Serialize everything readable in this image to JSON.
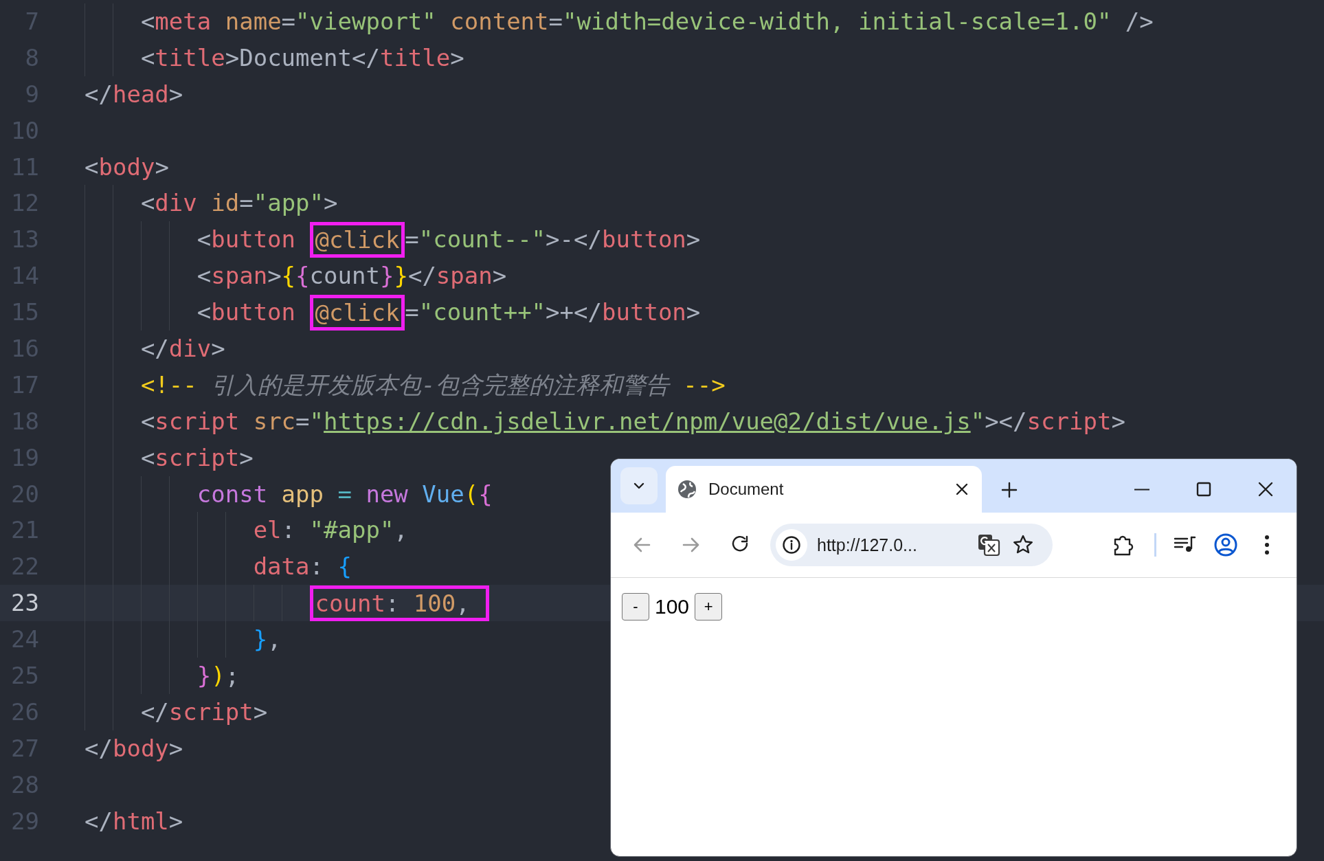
{
  "editor": {
    "lines": [
      {
        "number": "7",
        "current": false,
        "tokens": [
          {
            "text": "    <",
            "kind": "punct"
          },
          {
            "text": "meta",
            "kind": "tag"
          },
          {
            "text": " name",
            "kind": "attr"
          },
          {
            "text": "=",
            "kind": "punct"
          },
          {
            "text": "\"viewport\"",
            "kind": "string"
          },
          {
            "text": " content",
            "kind": "attr"
          },
          {
            "text": "=",
            "kind": "punct"
          },
          {
            "text": "\"width=device-width, initial-scale=1.0\"",
            "kind": "string"
          },
          {
            "text": " />",
            "kind": "punct"
          }
        ]
      },
      {
        "number": "8",
        "current": false,
        "tokens": [
          {
            "text": "    <",
            "kind": "punct"
          },
          {
            "text": "title",
            "kind": "tag"
          },
          {
            "text": ">",
            "kind": "punct"
          },
          {
            "text": "Document",
            "kind": "text"
          },
          {
            "text": "</",
            "kind": "punct"
          },
          {
            "text": "title",
            "kind": "tag"
          },
          {
            "text": ">",
            "kind": "punct"
          }
        ]
      },
      {
        "number": "9",
        "current": false,
        "tokens": [
          {
            "text": "</",
            "kind": "punct"
          },
          {
            "text": "head",
            "kind": "tag"
          },
          {
            "text": ">",
            "kind": "punct"
          }
        ]
      },
      {
        "number": "10",
        "current": false
      },
      {
        "number": "11",
        "current": false,
        "tokens": [
          {
            "text": "<",
            "kind": "punct"
          },
          {
            "text": "body",
            "kind": "tag"
          },
          {
            "text": ">",
            "kind": "punct"
          }
        ]
      },
      {
        "number": "12",
        "current": false,
        "tokens": [
          {
            "text": "    <",
            "kind": "punct"
          },
          {
            "text": "div",
            "kind": "tag"
          },
          {
            "text": " id",
            "kind": "attr"
          },
          {
            "text": "=",
            "kind": "punct"
          },
          {
            "text": "\"app\"",
            "kind": "string"
          },
          {
            "text": ">",
            "kind": "punct"
          }
        ]
      },
      {
        "number": "13",
        "current": false,
        "tokens": [
          {
            "text": "        <",
            "kind": "punct"
          },
          {
            "text": "button ",
            "kind": "tag"
          },
          {
            "kind": "highlight",
            "tokens": [
              {
                "text": "@click",
                "kind": "attr"
              }
            ]
          },
          {
            "text": "=",
            "kind": "punct"
          },
          {
            "text": "\"count--\"",
            "kind": "string"
          },
          {
            "text": ">",
            "kind": "punct"
          },
          {
            "text": "-",
            "kind": "text"
          },
          {
            "text": "</",
            "kind": "punct"
          },
          {
            "text": "button",
            "kind": "tag"
          },
          {
            "text": ">",
            "kind": "punct"
          }
        ]
      },
      {
        "number": "14",
        "current": false,
        "tokens": [
          {
            "text": "        <",
            "kind": "punct"
          },
          {
            "text": "span",
            "kind": "tag"
          },
          {
            "text": ">",
            "kind": "punct"
          },
          {
            "text": "{",
            "kind": "bracket1"
          },
          {
            "text": "{",
            "kind": "bracket2"
          },
          {
            "text": "count",
            "kind": "text"
          },
          {
            "text": "}",
            "kind": "bracket2"
          },
          {
            "text": "}",
            "kind": "bracket1"
          },
          {
            "text": "</",
            "kind": "punct"
          },
          {
            "text": "span",
            "kind": "tag"
          },
          {
            "text": ">",
            "kind": "punct"
          }
        ]
      },
      {
        "number": "15",
        "current": false,
        "tokens": [
          {
            "text": "        <",
            "kind": "punct"
          },
          {
            "text": "button ",
            "kind": "tag"
          },
          {
            "kind": "highlight",
            "tokens": [
              {
                "text": "@click",
                "kind": "attr"
              }
            ]
          },
          {
            "text": "=",
            "kind": "punct"
          },
          {
            "text": "\"count++\"",
            "kind": "string"
          },
          {
            "text": ">",
            "kind": "punct"
          },
          {
            "text": "+",
            "kind": "text"
          },
          {
            "text": "</",
            "kind": "punct"
          },
          {
            "text": "button",
            "kind": "tag"
          },
          {
            "text": ">",
            "kind": "punct"
          }
        ]
      },
      {
        "number": "16",
        "current": false,
        "tokens": [
          {
            "text": "    </",
            "kind": "punct"
          },
          {
            "text": "div",
            "kind": "tag"
          },
          {
            "text": ">",
            "kind": "punct"
          }
        ]
      },
      {
        "number": "17",
        "current": false,
        "tokens": [
          {
            "text": "    <!--",
            "kind": "comment-mark"
          },
          {
            "text": " 引入的是开发版本包-包含完整的注释和警告 ",
            "kind": "comment"
          },
          {
            "text": "-->",
            "kind": "comment-mark"
          }
        ]
      },
      {
        "number": "18",
        "current": false,
        "tokens": [
          {
            "text": "    <",
            "kind": "punct"
          },
          {
            "text": "script",
            "kind": "tag"
          },
          {
            "text": " src",
            "kind": "attr"
          },
          {
            "text": "=",
            "kind": "punct"
          },
          {
            "text": "\"",
            "kind": "string"
          },
          {
            "text": "https://cdn.jsdelivr.net/npm/vue@2/dist/vue.js",
            "kind": "link"
          },
          {
            "text": "\"",
            "kind": "string"
          },
          {
            "text": "></",
            "kind": "punct"
          },
          {
            "text": "script",
            "kind": "tag"
          },
          {
            "text": ">",
            "kind": "punct"
          }
        ]
      },
      {
        "number": "19",
        "current": false,
        "tokens": [
          {
            "text": "    <",
            "kind": "punct"
          },
          {
            "text": "script",
            "kind": "tag"
          },
          {
            "text": ">",
            "kind": "punct"
          }
        ]
      },
      {
        "number": "20",
        "current": false,
        "tokens": [
          {
            "text": "        const ",
            "kind": "keyword"
          },
          {
            "text": "app ",
            "kind": "variable"
          },
          {
            "text": "= ",
            "kind": "operator"
          },
          {
            "text": "new ",
            "kind": "keyword"
          },
          {
            "text": "Vue",
            "kind": "class"
          },
          {
            "text": "(",
            "kind": "bracket1"
          },
          {
            "text": "{",
            "kind": "bracket2"
          }
        ]
      },
      {
        "number": "21",
        "current": false,
        "tokens": [
          {
            "text": "            el",
            "kind": "property"
          },
          {
            "text": ": ",
            "kind": "punct"
          },
          {
            "text": "\"#app\"",
            "kind": "string"
          },
          {
            "text": ",",
            "kind": "punct"
          }
        ]
      },
      {
        "number": "22",
        "current": false,
        "tokens": [
          {
            "text": "            data",
            "kind": "property"
          },
          {
            "text": ": ",
            "kind": "punct"
          },
          {
            "text": "{",
            "kind": "bracket3"
          }
        ]
      },
      {
        "number": "23",
        "current": true,
        "tokens": [
          {
            "kind": "highlight",
            "tokens": [
              {
                "text": "                count",
                "kind": "property"
              },
              {
                "text": ": ",
                "kind": "punct"
              },
              {
                "text": "100",
                "kind": "number"
              },
              {
                "text": ", ",
                "kind": "punct"
              }
            ]
          }
        ]
      },
      {
        "number": "24",
        "current": false,
        "tokens": [
          {
            "text": "            }",
            "kind": "bracket3"
          },
          {
            "text": ",",
            "kind": "punct"
          }
        ]
      },
      {
        "number": "25",
        "current": false,
        "tokens": [
          {
            "text": "        }",
            "kind": "bracket2"
          },
          {
            "text": ")",
            "kind": "bracket1"
          },
          {
            "text": ";",
            "kind": "punct"
          }
        ]
      },
      {
        "number": "26",
        "current": false,
        "tokens": [
          {
            "text": "    </",
            "kind": "punct"
          },
          {
            "text": "script",
            "kind": "tag"
          },
          {
            "text": ">",
            "kind": "punct"
          }
        ]
      },
      {
        "number": "27",
        "current": false,
        "tokens": [
          {
            "text": "</",
            "kind": "punct"
          },
          {
            "text": "body",
            "kind": "tag"
          },
          {
            "text": ">",
            "kind": "punct"
          }
        ]
      },
      {
        "number": "28",
        "current": false
      },
      {
        "number": "29",
        "current": false,
        "tokens": [
          {
            "text": "</",
            "kind": "punct"
          },
          {
            "text": "html",
            "kind": "tag"
          },
          {
            "text": ">",
            "kind": "punct"
          }
        ]
      }
    ]
  },
  "browser": {
    "tab": {
      "title": "Document"
    },
    "address": {
      "url": "http://127.0..."
    },
    "page": {
      "decrement": "-",
      "count": "100",
      "increment": "+"
    }
  }
}
